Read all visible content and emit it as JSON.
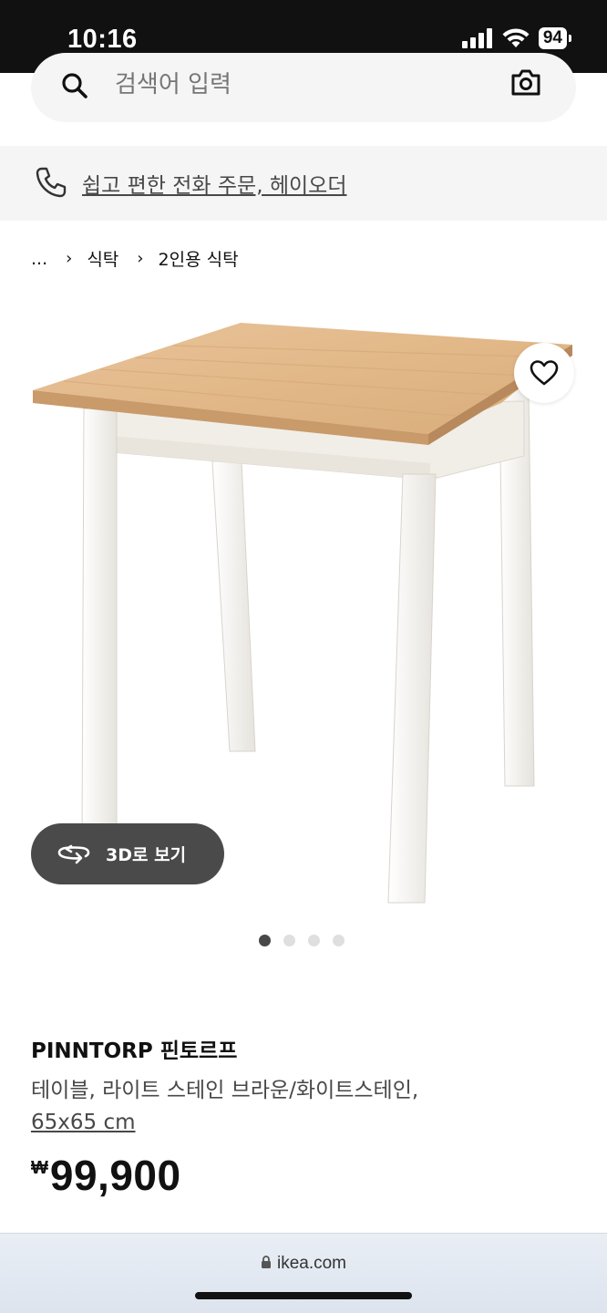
{
  "status_bar": {
    "time": "10:16",
    "battery": "94"
  },
  "search": {
    "placeholder": "검색어 입력"
  },
  "phone_banner": {
    "text": "쉽고 편한 전화 주문, 헤이오더"
  },
  "breadcrumb": [
    {
      "label": "..."
    },
    {
      "label": "식탁"
    },
    {
      "label": "2인용 식탁"
    }
  ],
  "gallery": {
    "view3d_label": "3D로 보기",
    "dot_count": 4,
    "active_dot": 0
  },
  "product": {
    "name": "PINNTORP 핀토르프",
    "description": "테이블, 라이트 스테인 브라운/화이트스테인,",
    "size": "65x65 cm",
    "currency": "₩",
    "price": "99,900"
  },
  "browser": {
    "url": "ikea.com"
  },
  "icons": [
    "signal-icon",
    "wifi-icon",
    "battery-icon",
    "search-icon",
    "camera-icon",
    "phone-icon",
    "chevron-right-icon",
    "heart-icon",
    "rotate-icon",
    "lock-icon"
  ],
  "colors": {
    "tabletop": "#e2b888",
    "legs": "#f4f2ee",
    "dark_button": "#4a4a4a",
    "status_bar": "#111111"
  }
}
